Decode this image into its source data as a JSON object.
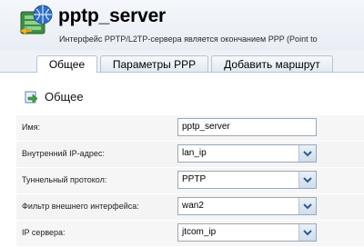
{
  "header": {
    "title": "pptp_server",
    "subtitle": "Интерфейс PPTP/L2TP-сервера является окончанием PPP (Point to"
  },
  "tabs": [
    {
      "label": "Общее",
      "active": true
    },
    {
      "label": "Параметры PPP",
      "active": false
    },
    {
      "label": "Добавить маршрут",
      "active": false
    }
  ],
  "section": {
    "title": "Общее",
    "icon": "arrow-edit-icon"
  },
  "form": {
    "rows": [
      {
        "label": "Имя:",
        "value": "pptp_server",
        "type": "text"
      },
      {
        "label": "Внутренний IP-адрес:",
        "value": "lan_ip",
        "type": "select"
      },
      {
        "label": "Туннельный протокол:",
        "value": "PPTP",
        "type": "select"
      },
      {
        "label": "Фильтр внешнего интерфейса:",
        "value": "wan2",
        "type": "select"
      },
      {
        "label": "IP сервера:",
        "value": "jtcom_ip",
        "type": "select"
      }
    ]
  },
  "colors": {
    "header_bg": "#eef2f7",
    "accent_blue": "#3d6fb6",
    "dropdown_arrow": "#2f5a8f"
  }
}
